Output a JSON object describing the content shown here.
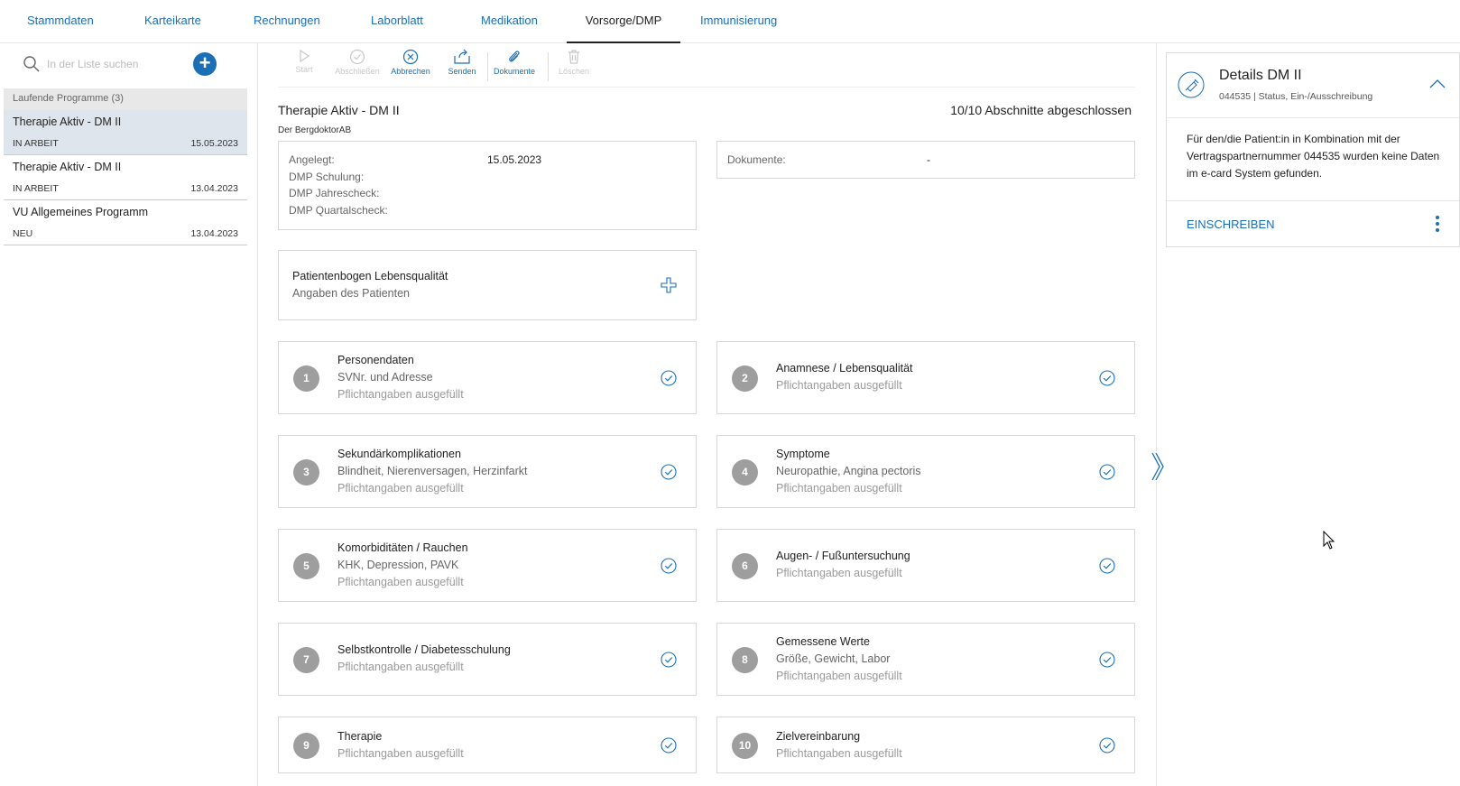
{
  "tabs": [
    {
      "label": "Stammdaten"
    },
    {
      "label": "Karteikarte"
    },
    {
      "label": "Rechnungen"
    },
    {
      "label": "Laborblatt"
    },
    {
      "label": "Medikation"
    },
    {
      "label": "Vorsorge/DMP"
    },
    {
      "label": "Immunisierung"
    }
  ],
  "sidebar": {
    "search_placeholder": "In der Liste suchen",
    "group_header": "Laufende Programme (3)",
    "items": [
      {
        "title": "Therapie Aktiv - DM II",
        "status": "IN ARBEIT",
        "date": "15.05.2023"
      },
      {
        "title": "Therapie Aktiv - DM II",
        "status": "IN ARBEIT",
        "date": "13.04.2023"
      },
      {
        "title": "VU Allgemeines Programm",
        "status": "NEU",
        "date": "13.04.2023"
      }
    ]
  },
  "toolbar": {
    "start": "Start",
    "abschliessen": "Abschließen",
    "abbrechen": "Abbrechen",
    "senden": "Senden",
    "dokumente": "Dokumente",
    "loeschen": "Löschen"
  },
  "main": {
    "title": "Therapie Aktiv - DM II",
    "progress": "10/10 Abschnitte abgeschlossen",
    "subtitle": "Der BergdoktorAB",
    "info": {
      "angelegt_label": "Angelegt:",
      "angelegt_value": "15.05.2023",
      "schulung_label": "DMP Schulung:",
      "jahrescheck_label": "DMP Jahrescheck:",
      "quartalscheck_label": "DMP Quartalscheck:"
    },
    "documents": {
      "label": "Dokumente:",
      "value": "-"
    },
    "questionnaire": {
      "title": "Patientenbogen Lebensqualität",
      "subtitle": "Angaben des Patienten"
    },
    "sections": [
      {
        "num": "1",
        "title": "Personendaten",
        "detail": "SVNr. und Adresse",
        "status": "Pflichtangaben ausgefüllt"
      },
      {
        "num": "2",
        "title": "Anamnese / Lebensqualität",
        "detail": "",
        "status": "Pflichtangaben ausgefüllt"
      },
      {
        "num": "3",
        "title": "Sekundärkomplikationen",
        "detail": "Blindheit, Nierenversagen, Herzinfarkt",
        "status": "Pflichtangaben ausgefüllt"
      },
      {
        "num": "4",
        "title": "Symptome",
        "detail": "Neuropathie, Angina pectoris",
        "status": "Pflichtangaben ausgefüllt"
      },
      {
        "num": "5",
        "title": "Komorbiditäten / Rauchen",
        "detail": "KHK, Depression, PAVK",
        "status": "Pflichtangaben ausgefüllt"
      },
      {
        "num": "6",
        "title": "Augen- / Fußuntersuchung",
        "detail": "",
        "status": "Pflichtangaben ausgefüllt"
      },
      {
        "num": "7",
        "title": "Selbstkontrolle / Diabetesschulung",
        "detail": "",
        "status": "Pflichtangaben ausgefüllt"
      },
      {
        "num": "8",
        "title": "Gemessene Werte",
        "detail": "Größe, Gewicht, Labor",
        "status": "Pflichtangaben ausgefüllt"
      },
      {
        "num": "9",
        "title": "Therapie",
        "detail": "",
        "status": "Pflichtangaben ausgefüllt"
      },
      {
        "num": "10",
        "title": "Zielvereinbarung",
        "detail": "",
        "status": "Pflichtangaben ausgefüllt"
      }
    ]
  },
  "details": {
    "title": "Details DM II",
    "subtitle": "044535 | Status, Ein-/Ausschreibung",
    "message": "Für den/die Patient:in in Kombination mit der Vertragspartnernummer 044535 wurden keine Daten im e-card System gefunden.",
    "enroll_label": "EINSCHREIBEN"
  },
  "colors": {
    "accent": "#1a6fb5",
    "selected_row": "#dfe5ec",
    "number_badge": "#9e9e9e"
  }
}
